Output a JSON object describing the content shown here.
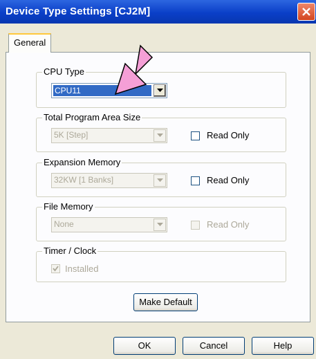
{
  "window": {
    "title": "Device Type Settings [CJ2M]",
    "close_icon": "close-icon"
  },
  "tabs": [
    {
      "label": "General",
      "selected": true
    }
  ],
  "groups": {
    "cpu_type": {
      "legend": "CPU Type",
      "value": "CPU11",
      "enabled": true
    },
    "program_area": {
      "legend": "Total Program Area Size",
      "value": "5K [Step]",
      "read_only_label": "Read Only",
      "read_only_checked": false
    },
    "expansion_memory": {
      "legend": "Expansion Memory",
      "value": "32KW [1 Banks]",
      "read_only_label": "Read Only",
      "read_only_checked": false
    },
    "file_memory": {
      "legend": "File Memory",
      "value": "None",
      "read_only_label": "Read Only",
      "read_only_checked": false
    },
    "timer_clock": {
      "legend": "Timer / Clock",
      "installed_label": "Installed",
      "installed_checked": true
    }
  },
  "buttons": {
    "make_default": "Make Default",
    "ok": "OK",
    "cancel": "Cancel",
    "help": "Help"
  },
  "annotation": {
    "arrow_color": "#f59fd6"
  },
  "colors": {
    "title_bar": "#0a3fc8",
    "selection": "#316ac5",
    "dialog_bg": "#ece9d8"
  }
}
